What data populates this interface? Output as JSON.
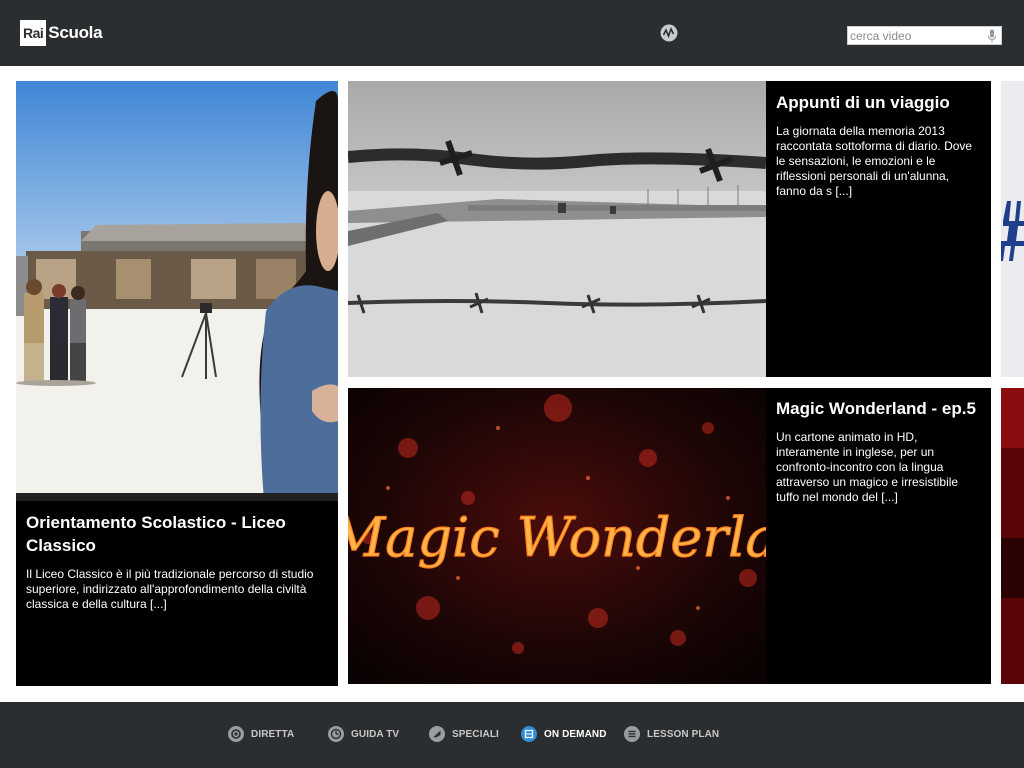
{
  "header": {
    "logo_rai": "Rai",
    "logo_scuola": "Scuola",
    "search_placeholder": "cerca video"
  },
  "tiles": [
    {
      "title": "Orientamento Scolastico - Liceo Classico",
      "description": "  Il Liceo Classico è il più tradizionale percorso di studio superiore, indirizzato all'approfondimento della civiltà classica e della cultura [...]"
    },
    {
      "title": "Appunti di un viaggio",
      "description": "La giornata della memoria 2013 raccontata sottoforma di diario. Dove le sensazioni, le emozioni e le riflessioni personali di un'alunna, fanno da s [...]"
    },
    {
      "title": "Magic Wonderland - ep.5",
      "description": "Un cartone animato in HD, interamente in inglese, per un confronto-incontro con la lingua attraverso  un magico e irresistibile tuffo nel mondo del [...]",
      "image_text": "Magic Wonderland"
    }
  ],
  "footer": {
    "nav": [
      {
        "label": "DIRETTA",
        "icon": "live-icon",
        "active": false
      },
      {
        "label": "GUIDA TV",
        "icon": "tv-guide-icon",
        "active": false
      },
      {
        "label": "SPECIALI",
        "icon": "specials-icon",
        "active": false
      },
      {
        "label": "ON DEMAND",
        "icon": "on-demand-icon",
        "active": true
      },
      {
        "label": "LESSON PLAN",
        "icon": "lesson-plan-icon",
        "active": false
      }
    ]
  },
  "colors": {
    "bar_bg": "#2b2e31",
    "accent": "#2f8ed8"
  }
}
